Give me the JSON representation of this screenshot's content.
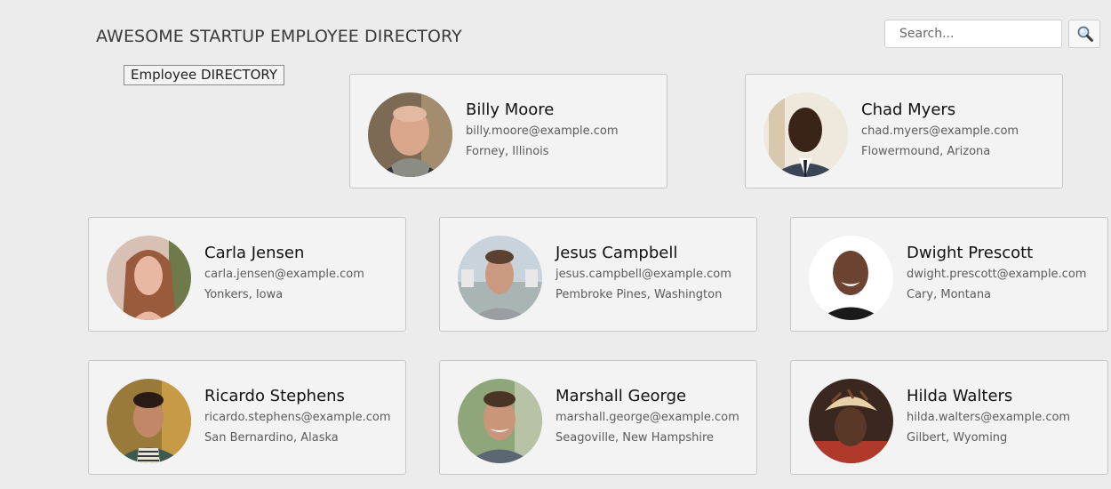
{
  "header": {
    "title": "AWESOME STARTUP EMPLOYEE DIRECTORY",
    "badge": "Employee DIRECTORY"
  },
  "search": {
    "placeholder": "Search...",
    "value": "",
    "button_icon": "search-icon"
  },
  "employees": [
    {
      "name": "Billy Moore",
      "email": "billy.moore@example.com",
      "location": "Forney, Illinois",
      "photo": "avatar-billy-moore"
    },
    {
      "name": "Chad Myers",
      "email": "chad.myers@example.com",
      "location": "Flowermound, Arizona",
      "photo": "avatar-chad-myers"
    },
    {
      "name": "Carla Jensen",
      "email": "carla.jensen@example.com",
      "location": "Yonkers, Iowa",
      "photo": "avatar-carla-jensen"
    },
    {
      "name": "Jesus Campbell",
      "email": "jesus.campbell@example.com",
      "location": "Pembroke Pines, Washington",
      "photo": "avatar-jesus-campbell"
    },
    {
      "name": "Dwight Prescott",
      "email": "dwight.prescott@example.com",
      "location": "Cary, Montana",
      "photo": "avatar-dwight-prescott"
    },
    {
      "name": "Ricardo Stephens",
      "email": "ricardo.stephens@example.com",
      "location": "San Bernardino, Alaska",
      "photo": "avatar-ricardo-stephens"
    },
    {
      "name": "Marshall George",
      "email": "marshall.george@example.com",
      "location": "Seagoville, New Hampshire",
      "photo": "avatar-marshall-george"
    },
    {
      "name": "Hilda Walters",
      "email": "hilda.walters@example.com",
      "location": "Gilbert, Wyoming",
      "photo": "avatar-hilda-walters"
    }
  ],
  "colors": {
    "page_background": "#ececec",
    "card_background": "#f3f3f3",
    "card_border": "#c7c7c7",
    "name_text": "#111111",
    "detail_text": "#5c5c5c"
  }
}
